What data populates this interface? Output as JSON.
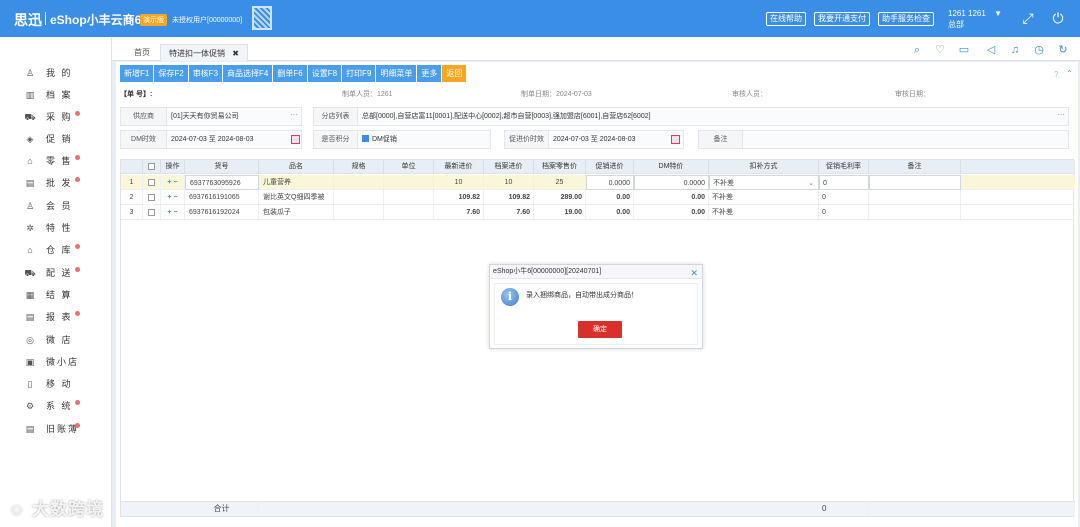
{
  "header": {
    "brand": "思迅",
    "app_name": "eShop小丰云商6",
    "demo_badge": "演示版",
    "unauth_text": "未授权用户[00000000]",
    "buttons": [
      "在线帮助",
      "我要开通支付",
      "助手服务检查"
    ],
    "user_line1": "1261 1261",
    "user_caret": "▼",
    "user_line2": "总部",
    "accent_color": "#3a8ee6"
  },
  "sidebar": {
    "items": [
      {
        "label": "我 的",
        "icon": "user-icon",
        "dot": false
      },
      {
        "label": "档 案",
        "icon": "archive-icon",
        "dot": false
      },
      {
        "label": "采 购",
        "icon": "cart-icon",
        "dot": true
      },
      {
        "label": "促 销",
        "icon": "tag-icon",
        "dot": false
      },
      {
        "label": "零 售",
        "icon": "bag-icon",
        "dot": true
      },
      {
        "label": "批 发",
        "icon": "chart-icon",
        "dot": true
      },
      {
        "label": "会 员",
        "icon": "member-icon",
        "dot": false
      },
      {
        "label": "特 性",
        "icon": "star-icon",
        "dot": false
      },
      {
        "label": "仓 库",
        "icon": "warehouse-icon",
        "dot": true
      },
      {
        "label": "配 送",
        "icon": "truck-icon",
        "dot": true
      },
      {
        "label": "结 算",
        "icon": "settle-icon",
        "dot": false
      },
      {
        "label": "报 表",
        "icon": "report-icon",
        "dot": true
      },
      {
        "label": "微 店",
        "icon": "shop-icon",
        "dot": false
      },
      {
        "label": "微小店",
        "icon": "mini-shop-icon",
        "dot": false
      },
      {
        "label": "移 动",
        "icon": "mobile-icon",
        "dot": false
      },
      {
        "label": "系 统",
        "icon": "settings-icon",
        "dot": true
      },
      {
        "label": "旧账薄",
        "icon": "ledger-icon",
        "dot": true
      }
    ],
    "watermark": "大数跨境"
  },
  "tabs": {
    "home": "首页",
    "active": "特进扣一体促销",
    "close": "✖"
  },
  "toolbar": {
    "buttons": [
      "新增F1",
      "保存F2",
      "审核F3",
      "商品选择F4",
      "删单F6",
      "设置F8",
      "打印F9",
      "明细菜单",
      "更多"
    ],
    "back": "返回"
  },
  "form": {
    "doc_no_label": "【单    号】:",
    "creator_label": "制单人员：1261",
    "create_date_label": "制单日期：2024-07-03",
    "auditor_label": "审核人员：",
    "audit_date_label": "审核日期：",
    "supplier_label": "供应商",
    "supplier_value": "[01]天天有你贸易公司",
    "branch_label": "分店列表",
    "branch_value": "总部[0000],自营店富11[0001],配送中心[0002],超市自营[0003],强加盟店[6001],自营店62[6002]",
    "dm_time_label": "DM时效",
    "dm_start": "2024-07-03",
    "to_text": "至",
    "dm_end": "2024-08-03",
    "points_label": "是否积分",
    "dm_promo_label": "DM促销",
    "promo_time_label": "促进价时效",
    "promo_start": "2024-07-03",
    "promo_end": "2024-08-03",
    "remark_label": "备注"
  },
  "grid": {
    "headers": [
      "操作",
      "货号",
      "品名",
      "规格",
      "单位",
      "最新进价",
      "档案进价",
      "档案零售价",
      "促销进价",
      "DM特价",
      "扣补方式",
      "促销毛利率",
      "备注"
    ],
    "rows": [
      {
        "no": "1",
        "code": "6937763095926",
        "name": "儿童营养",
        "spec": "",
        "unit": "",
        "latest_price": "10",
        "archive_price": "10",
        "archive_retail": "25",
        "promo_price": "0.0000",
        "dm_price": "0.0000",
        "method": "不补差",
        "margin": "0",
        "remark": ""
      },
      {
        "no": "2",
        "code": "6937616191065",
        "name": "谢比英文Q细四季被",
        "spec": "",
        "unit": "",
        "latest_price": "109.82",
        "archive_price": "109.82",
        "archive_retail": "289.00",
        "promo_price": "0.00",
        "dm_price": "0.00",
        "method": "不补差",
        "margin": "0",
        "remark": ""
      },
      {
        "no": "3",
        "code": "6937616192024",
        "name": "包装瓜子",
        "spec": "",
        "unit": "",
        "latest_price": "7.60",
        "archive_price": "7.60",
        "archive_retail": "19.00",
        "promo_price": "0.00",
        "dm_price": "0.00",
        "method": "不补差",
        "margin": "0",
        "remark": ""
      }
    ],
    "plus": "+",
    "minus": "−",
    "footer_label": "合计",
    "footer_margin": "0"
  },
  "dialog": {
    "title": "eShop小牛6[00000000][20240701]",
    "close": "✕",
    "icon_glyph": "i",
    "message": "录入捆绑商品，自动带出成分商品！",
    "ok": "确定"
  }
}
